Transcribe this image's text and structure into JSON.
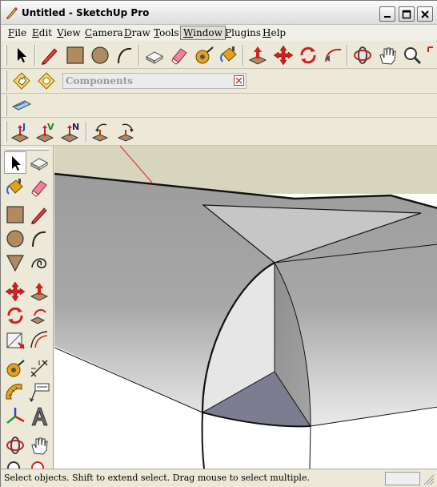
{
  "window": {
    "title": "Untitled - SketchUp Pro"
  },
  "menubar": {
    "items": [
      "File",
      "Edit",
      "View",
      "Camera",
      "Draw",
      "Tools",
      "Window",
      "Plugins",
      "Help"
    ],
    "active": "Window"
  },
  "components_toolbar": {
    "label": "Components"
  },
  "sandbox_labels": {
    "j": "J",
    "v": "V",
    "n": "N"
  },
  "status": {
    "text": "Select objects. Shift to extend select. Drag mouse to select multiple."
  },
  "colors": {
    "ground": "#d8d5bf",
    "face_light": "#e6e6e6",
    "face_mid": "#9e9e9e",
    "face_dark": "#7c7d91",
    "axis_red": "#e02020",
    "accent_orange": "#e4a21c"
  }
}
